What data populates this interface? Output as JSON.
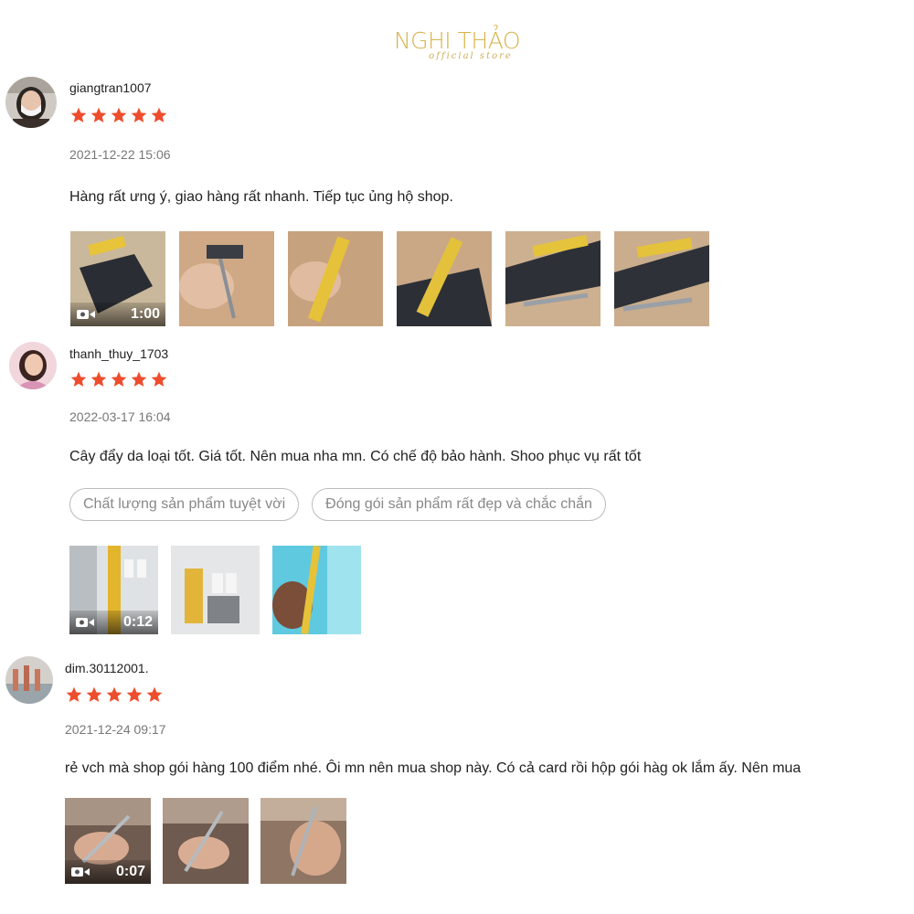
{
  "store": {
    "name": "NGHI THẢO",
    "tagline": "official store"
  },
  "colors": {
    "star": "#ee4d2d",
    "brand": "#d9b34c"
  },
  "reviews": [
    {
      "username": "giangtran1007",
      "rating": 5,
      "date": "2021-12-22 15:06",
      "text": "Hàng rất ưng ý, giao hàng rất nhanh. Tiếp tục ủng hộ shop.",
      "tags": [],
      "media": [
        {
          "type": "video",
          "duration": "1:00"
        },
        {
          "type": "image"
        },
        {
          "type": "image"
        },
        {
          "type": "image"
        },
        {
          "type": "image"
        },
        {
          "type": "image"
        }
      ]
    },
    {
      "username": "thanh_thuy_1703",
      "rating": 5,
      "date": "2022-03-17 16:04",
      "text": "Cây đẩy da loại tốt. Giá tốt. Nên mua nha mn. Có chế độ bảo hành. Shoo phục vụ rất tốt",
      "tags": [
        "Chất lượng sản phẩm tuyệt vời",
        "Đóng gói sản phẩm rất đẹp và chắc chắn"
      ],
      "media": [
        {
          "type": "video",
          "duration": "0:12"
        },
        {
          "type": "image"
        },
        {
          "type": "image"
        }
      ]
    },
    {
      "username": "dim.30112001.",
      "rating": 5,
      "date": "2021-12-24 09:17",
      "text": "rẻ vch mà shop gói hàng 100 điểm nhé. Ôi mn nên mua shop này. Có cả card rồi hộp gói hàg ok lắm ấy. Nên mua",
      "tags": [],
      "media": [
        {
          "type": "video",
          "duration": "0:07"
        },
        {
          "type": "image"
        },
        {
          "type": "image"
        }
      ]
    }
  ]
}
